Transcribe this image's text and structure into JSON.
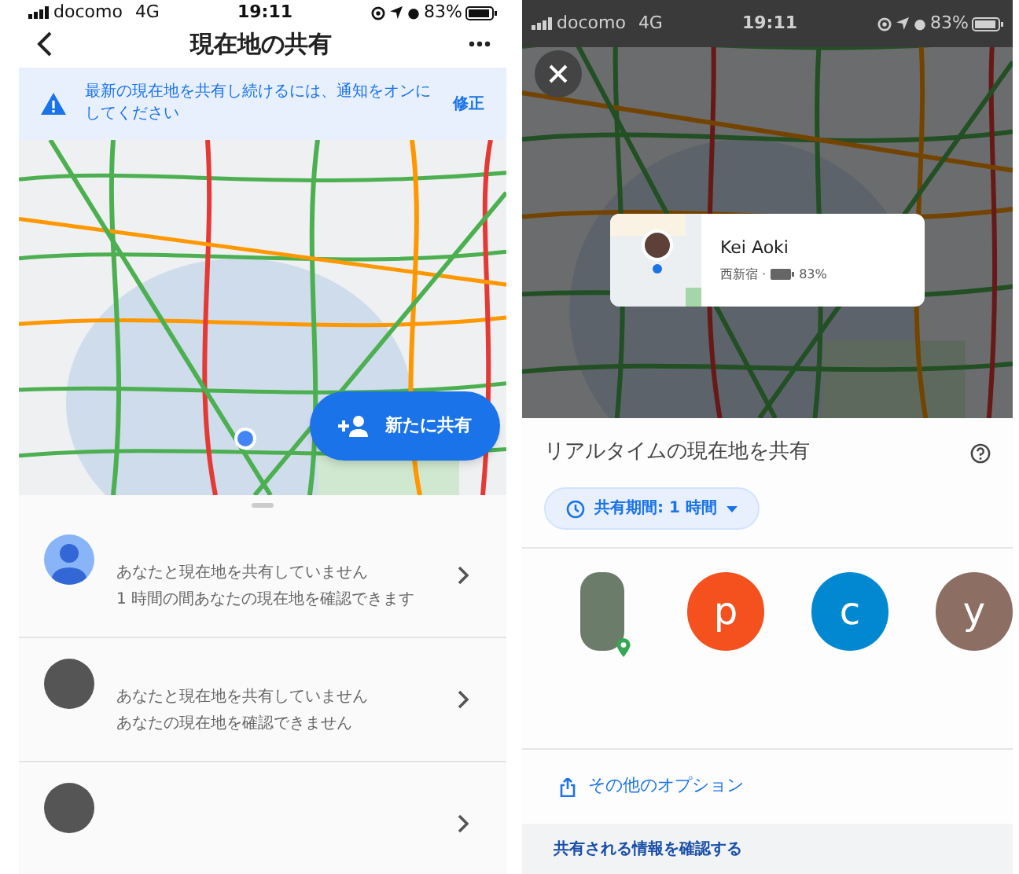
{
  "left_screen": {
    "status_bar": {
      "carrier": "docomo",
      "network": "4G",
      "time": "19:11",
      "battery": "83%"
    },
    "header": {
      "title": "現在地の共有"
    },
    "banner": {
      "message": "最新の現在地を共有し続けるには、通知をオンにしてください",
      "action": "修正"
    },
    "share_button": {
      "label": "新たに共有"
    },
    "contacts": [
      {
        "kind": "default",
        "line_1": "あなたと現在地を共有していません",
        "line_2": "1 時間の間あなたの現在地を確認できます"
      },
      {
        "kind": "photo",
        "line_1": "あなたと現在地を共有していません",
        "line_2": "あなたの現在地を確認できません"
      },
      {
        "kind": "photo"
      }
    ]
  },
  "right_screen": {
    "status_bar": {
      "carrier": "docomo",
      "network": "4G",
      "time": "19:11",
      "battery": "83%"
    },
    "location_card": {
      "name": "Kei Aoki",
      "place": "西新宿 ·",
      "battery": "83%"
    },
    "sheet_title": "リアルタイムの現在地を共有",
    "duration_chip": "共有期間: 1 時間",
    "recipients": [
      {
        "kind": "photo"
      },
      {
        "kind": "letter",
        "letter": "p",
        "color": "#f4511e"
      },
      {
        "kind": "letter",
        "letter": "c",
        "color": "#0288d1"
      },
      {
        "kind": "letter",
        "letter": "y",
        "color": "#8d6e63"
      }
    ],
    "more_options": "その他のオプション",
    "footer_link": "共有される情報を確認する"
  }
}
